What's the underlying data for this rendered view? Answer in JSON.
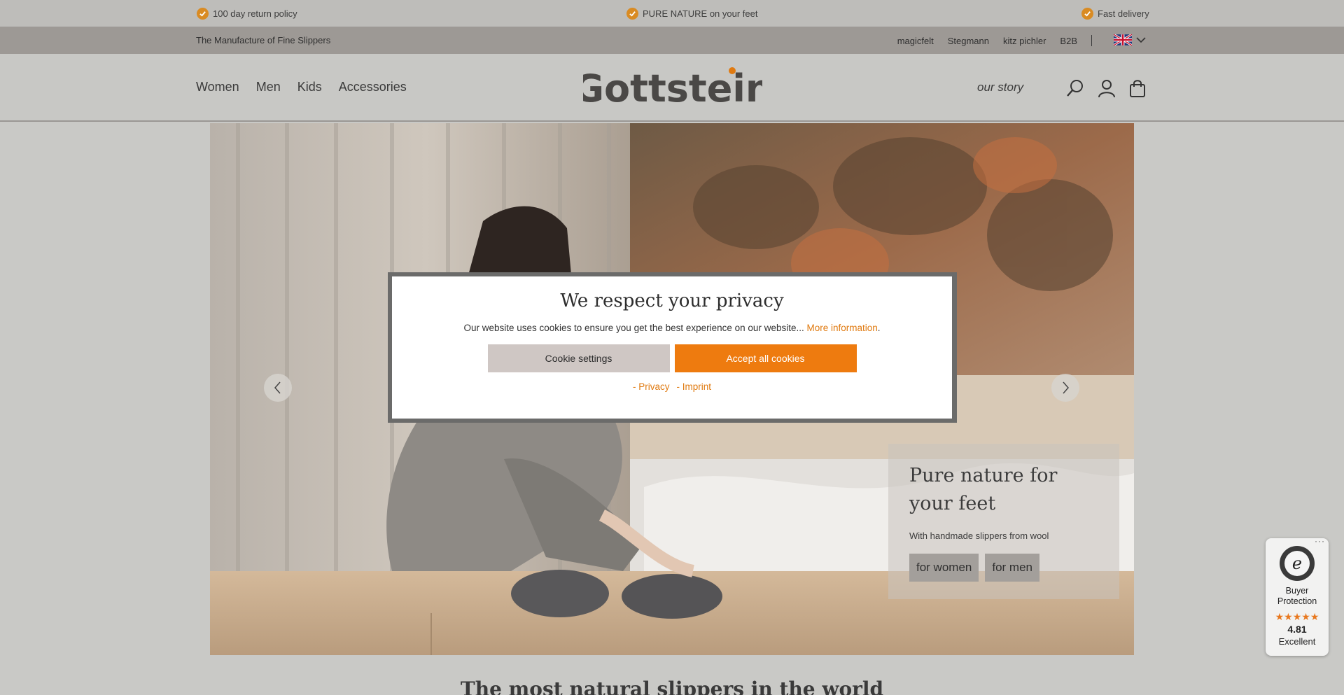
{
  "usp_bar": {
    "items": [
      {
        "label": "100 day return policy"
      },
      {
        "label": "PURE NATURE on your feet"
      },
      {
        "label": "Fast delivery"
      }
    ]
  },
  "sub_bar": {
    "tagline": "The Manufacture of Fine Slippers",
    "brand_links": [
      "magicfelt",
      "Stegmann",
      "kitz pichler",
      "B2B"
    ],
    "language": "English"
  },
  "header": {
    "nav": [
      "Women",
      "Men",
      "Kids",
      "Accessories"
    ],
    "logo_text": "Gottstein",
    "our_story": "our story",
    "icons": [
      "search-icon",
      "account-icon",
      "cart-icon"
    ]
  },
  "hero": {
    "title": "Pure nature for your feet",
    "subtitle": "With handmade slippers from wool",
    "buttons": [
      "for women",
      "for men"
    ]
  },
  "section": {
    "heading": "The most natural slippers in the world"
  },
  "cookie_modal": {
    "title": "We respect your privacy",
    "text": "Our website uses cookies to ensure you get the best experience on our website...",
    "more_link": "More information",
    "text_end": ".",
    "settings_button": "Cookie settings",
    "accept_button": "Accept all cookies",
    "privacy_link": "- Privacy",
    "imprint_link": "- Imprint"
  },
  "trusted_shops": {
    "label": "Buyer Protection",
    "stars": "★★★★★",
    "score": "4.81",
    "rating_text": "Excellent"
  },
  "colors": {
    "accent": "#ee7b0f",
    "check": "#d98b23",
    "top_bar": "#bebdba",
    "sub_bar": "#9d9995"
  }
}
